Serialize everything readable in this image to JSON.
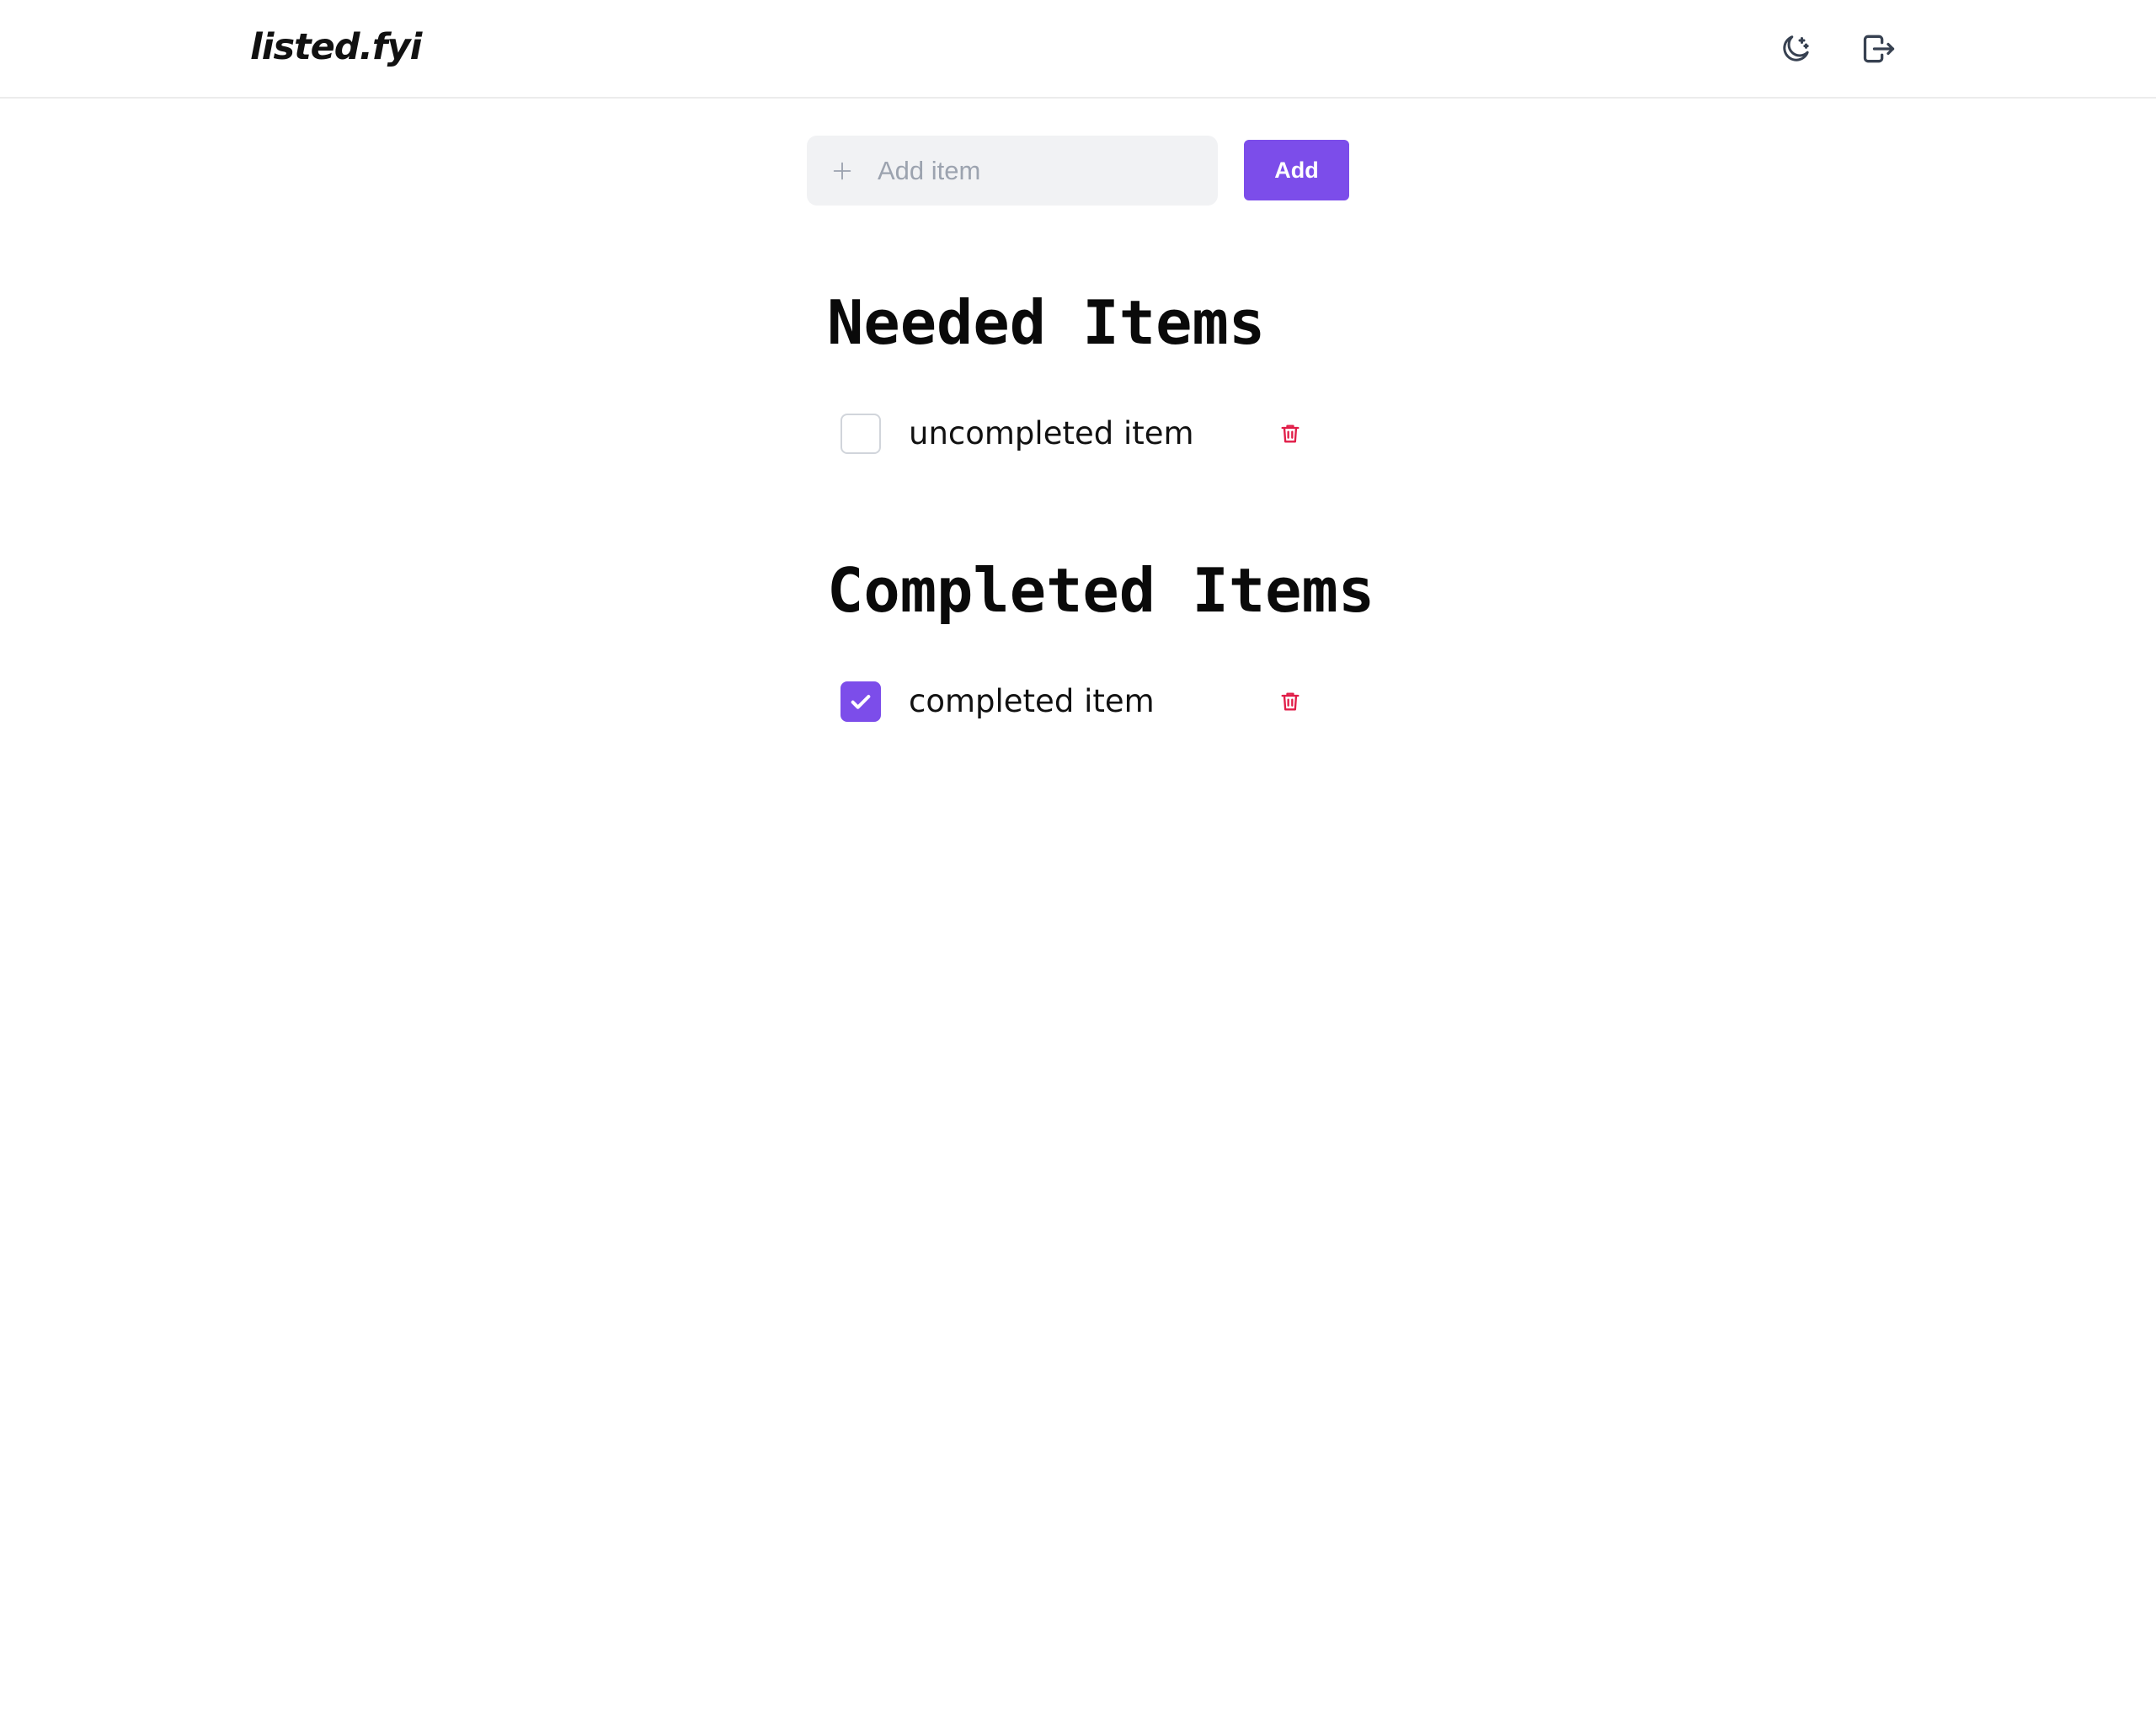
{
  "header": {
    "logo": "listed.fyi",
    "icons": [
      "moon-icon",
      "logout-icon"
    ]
  },
  "add_form": {
    "placeholder": "Add item",
    "value": "",
    "button_label": "Add",
    "accent_color": "#7c4dea"
  },
  "sections": {
    "needed": {
      "title": "Needed Items",
      "items": [
        {
          "label": "uncompleted item",
          "completed": false
        }
      ]
    },
    "completed": {
      "title": "Completed Items",
      "items": [
        {
          "label": "completed item",
          "completed": true
        }
      ]
    }
  },
  "colors": {
    "accent": "#7c4dea",
    "delete": "#e11d48",
    "input_bg": "#f1f2f4"
  }
}
